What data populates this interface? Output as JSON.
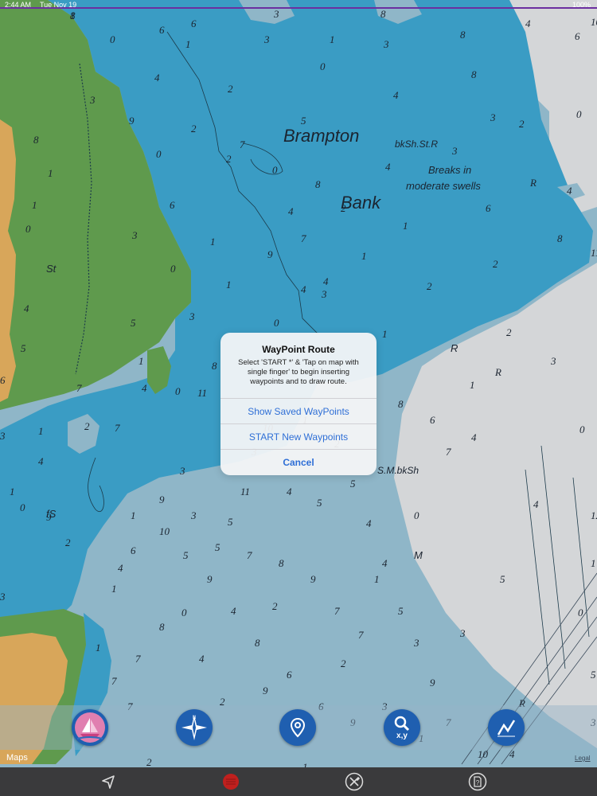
{
  "status_bar": {
    "time": "2:44 AM",
    "date": "Tue Nov 19",
    "battery": "100%"
  },
  "chart": {
    "labels": [
      "Brampton",
      "Bank",
      "Breaks in",
      "moderate swells",
      "bkSh.St.R",
      "S.M.bkSh",
      "St",
      "fS",
      "R",
      "M"
    ],
    "soundings": [
      "1",
      "0",
      "6",
      "6",
      "1",
      "3",
      "3",
      "1",
      "8",
      "3",
      "8",
      "4",
      "6",
      "4",
      "0",
      "8",
      "2",
      "4",
      "3",
      "9",
      "2",
      "5",
      "3",
      "2",
      "0",
      "7",
      "0",
      "2",
      "0",
      "4",
      "3",
      "R",
      "4",
      "8",
      "6",
      "4",
      "2",
      "6",
      "1",
      "7",
      "1",
      "9",
      "3",
      "8",
      "0",
      "1",
      "2",
      "1",
      "2",
      "4",
      "4",
      "3",
      "5",
      "3",
      "0",
      "1",
      "1",
      "8",
      "0",
      "4",
      "2",
      "1",
      "2",
      "7",
      "4",
      "3",
      "0",
      "9",
      "1",
      "5",
      "2",
      "6",
      "4",
      "1",
      "0",
      "2",
      "1",
      "5",
      "1",
      "7",
      "2",
      "2",
      "3",
      "R",
      "1",
      "2",
      "1",
      "3",
      "1",
      "R",
      "4",
      "0",
      "4",
      "0",
      "5",
      "0",
      "3",
      "6",
      "3",
      "10",
      "11",
      "7",
      "5",
      "4",
      "0",
      "1",
      "1",
      "8",
      "11",
      "1",
      "12",
      "1",
      "5",
      "3",
      "8",
      "6",
      "7",
      "1",
      "10",
      "3",
      "11",
      "4",
      "2",
      "5",
      "4",
      "4",
      "5",
      "3",
      "9",
      "7",
      "10",
      "4",
      "3",
      "9",
      "6",
      "6",
      "8",
      "4",
      "9",
      "5",
      "10",
      "9",
      "3",
      "5",
      "7",
      "8",
      "9",
      "7",
      "7",
      "9",
      "4",
      "8",
      "7",
      "7",
      "8"
    ]
  },
  "dialog": {
    "title": "WayPoint Route",
    "message": "Select 'START *' & 'Tap on map with single finger' to begin inserting waypoints and to draw route.",
    "buttons": [
      "Show Saved WayPoints",
      "START New Waypoints",
      "Cancel"
    ]
  },
  "toolbar": {
    "icons": [
      "sailboat-icon",
      "compass-icon",
      "location-pin-icon",
      "search-xy-icon",
      "route-graph-icon"
    ],
    "search_label": "x,y"
  },
  "map_attribution": {
    "logo": "Maps",
    "legal": "Legal"
  },
  "tab_bar": {
    "icons": [
      "navigate-arrow-icon",
      "record-stop-icon",
      "tools-icon",
      "help-document-icon"
    ]
  },
  "colors": {
    "deep_water": "#3a9cc4",
    "shallow_water": "#8fb6c8",
    "land_green": "#5f9a4d",
    "land_sand": "#d8a65a",
    "light_area": "#d4d6d8",
    "accent": "#1f5fb0"
  }
}
